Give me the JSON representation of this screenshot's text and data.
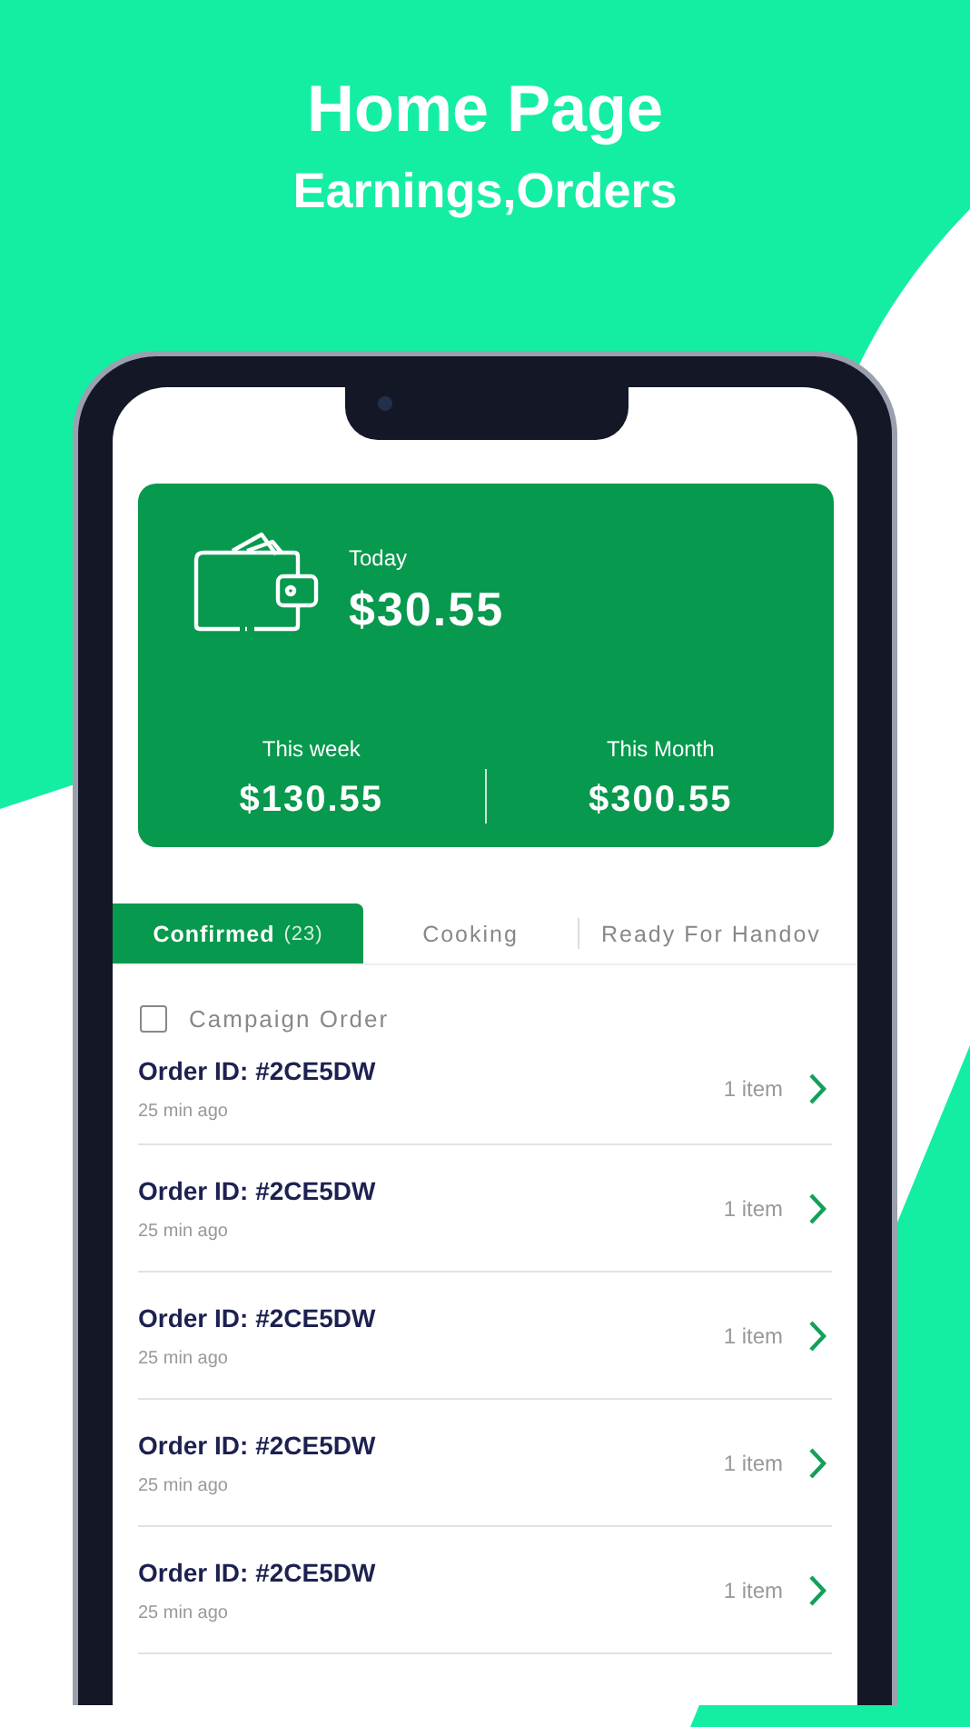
{
  "header": {
    "title": "Home Page",
    "subtitle": "Earnings,Orders"
  },
  "earnings": {
    "today_label": "Today",
    "today_amount": "$30.55",
    "stats": [
      {
        "label": "This week",
        "amount": "$130.55"
      },
      {
        "label": "This Month",
        "amount": "$300.55"
      }
    ]
  },
  "tabs": [
    {
      "label": "Confirmed",
      "count": "(23)",
      "selected": true
    },
    {
      "label": "Cooking",
      "selected": false
    },
    {
      "label": "Ready For Handov",
      "selected": false
    }
  ],
  "campaign_filter": {
    "label": "Campaign Order",
    "checked": false
  },
  "orders": [
    {
      "id": "Order ID: #2CE5DW",
      "time": "25 min ago",
      "items": "1 item"
    },
    {
      "id": "Order ID: #2CE5DW",
      "time": "25 min ago",
      "items": "1 item"
    },
    {
      "id": "Order ID: #2CE5DW",
      "time": "25 min ago",
      "items": "1 item"
    },
    {
      "id": "Order ID: #2CE5DW",
      "time": "25 min ago",
      "items": "1 item"
    },
    {
      "id": "Order ID: #2CE5DW",
      "time": "25 min ago",
      "items": "1 item"
    }
  ]
}
